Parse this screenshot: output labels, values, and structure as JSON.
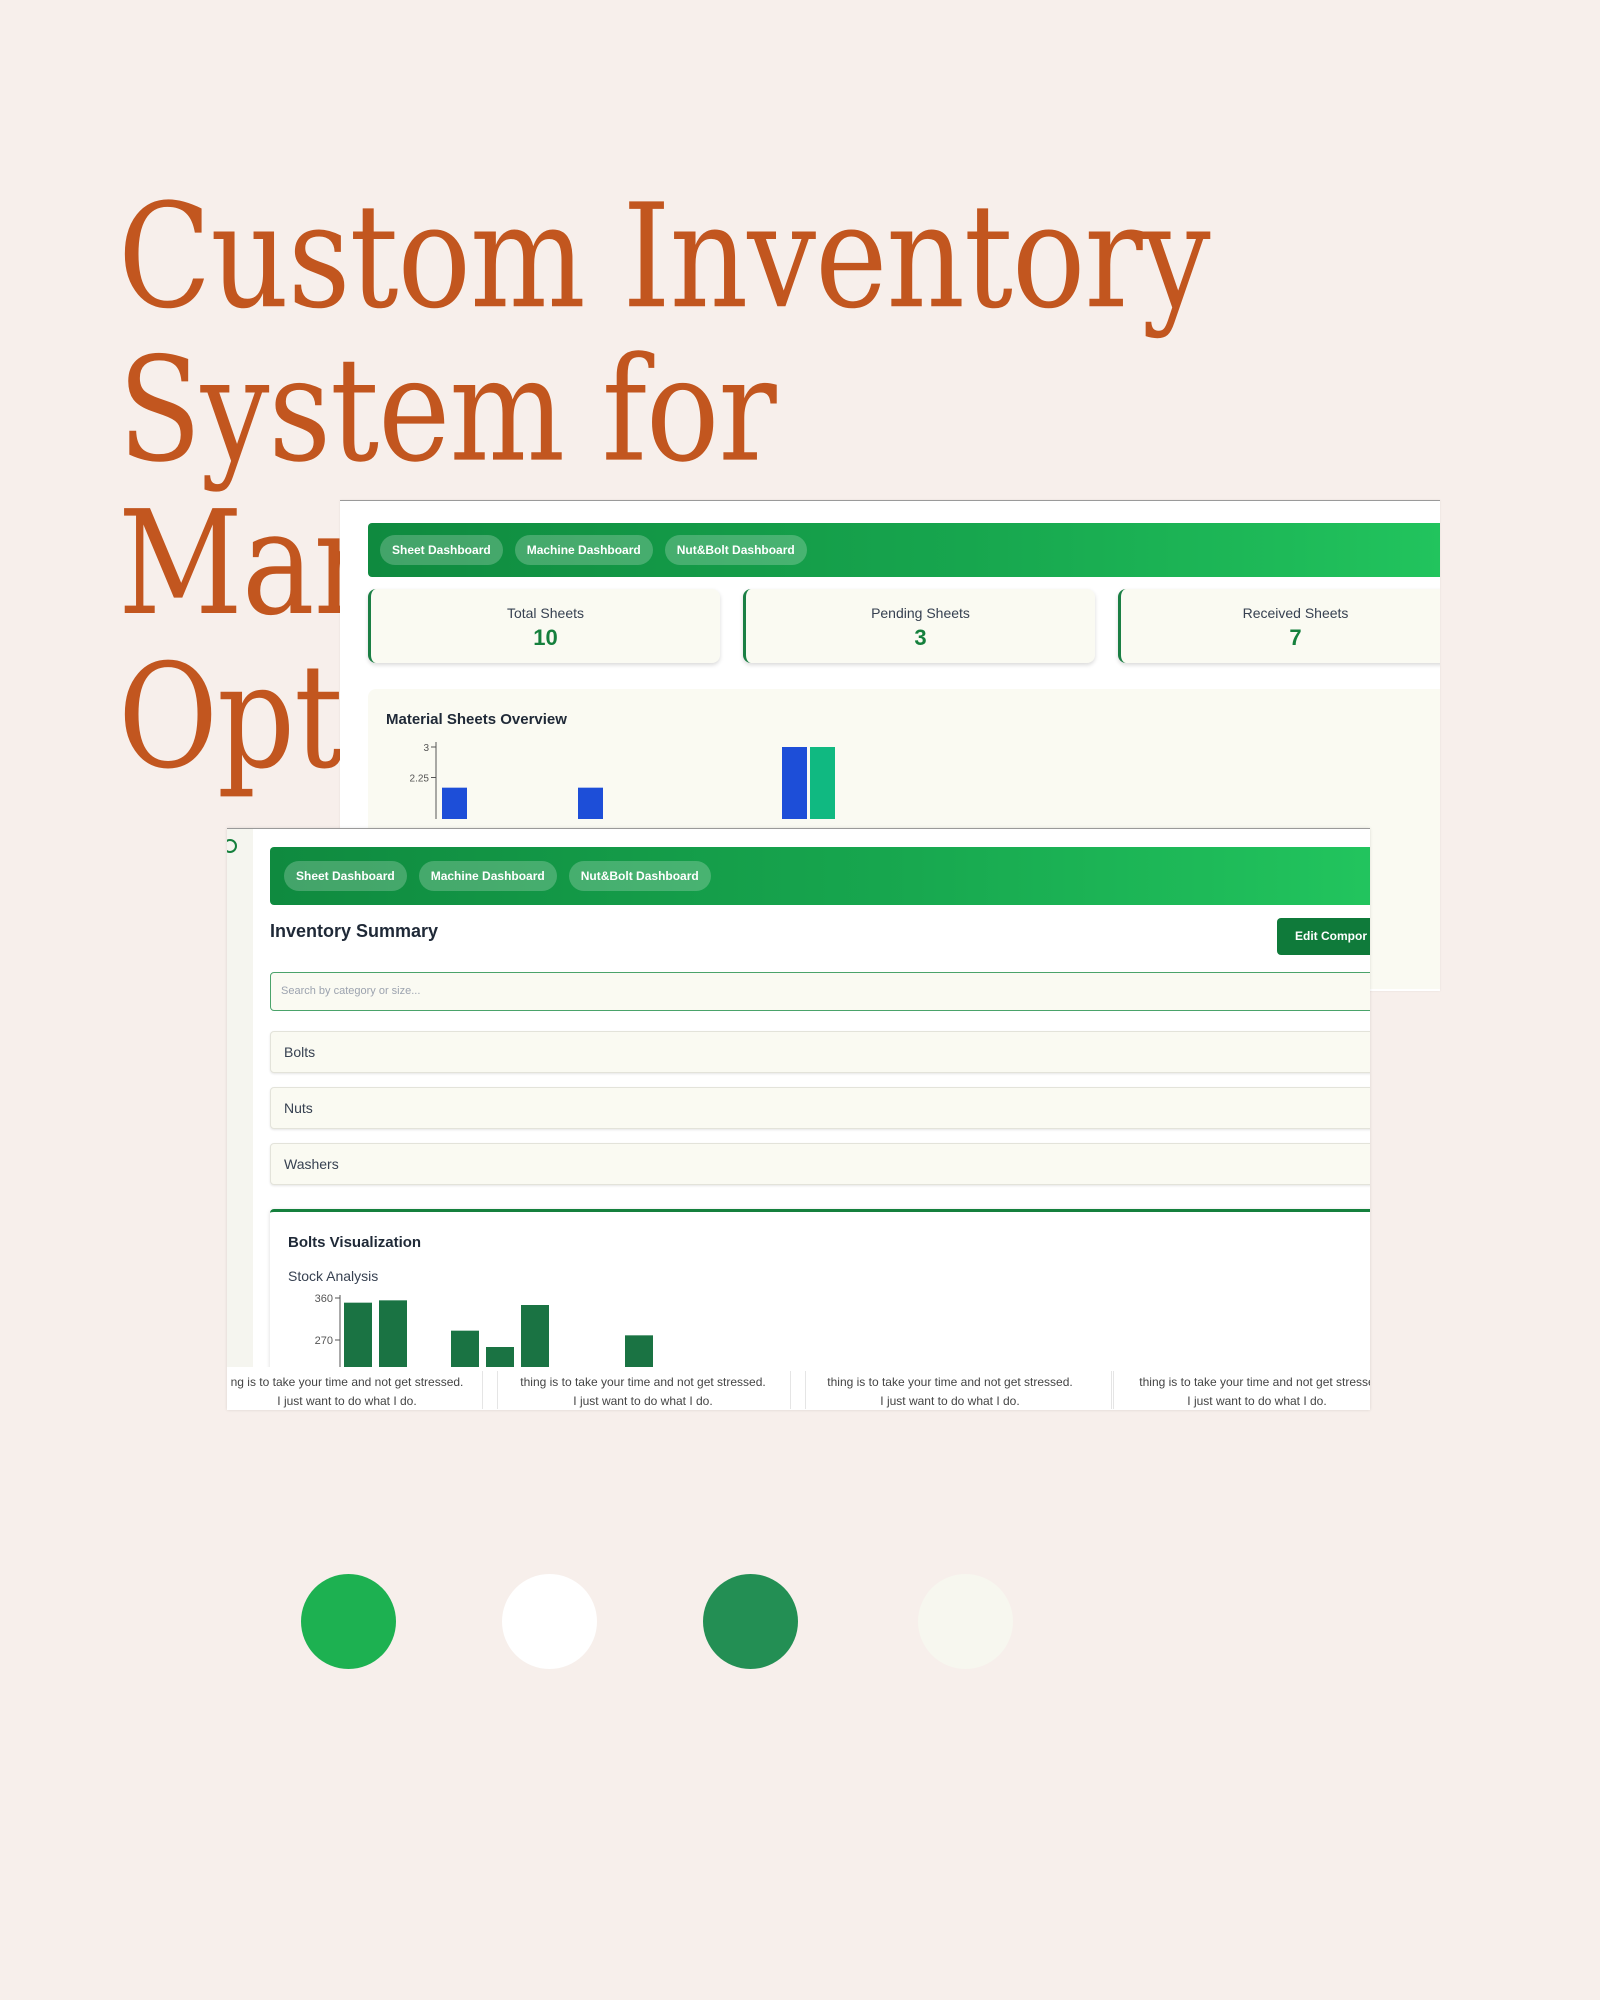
{
  "title": {
    "line1": "Custom Inventory System for",
    "line2": "Manufacturing Optimization"
  },
  "sheet_dashboard": {
    "nav": [
      "Sheet Dashboard",
      "Machine Dashboard",
      "Nut&Bolt Dashboard"
    ],
    "stats": [
      {
        "label": "Total Sheets",
        "value": "10"
      },
      {
        "label": "Pending Sheets",
        "value": "3"
      },
      {
        "label": "Received Sheets",
        "value": "7"
      }
    ],
    "chart_title": "Material Sheets Overview"
  },
  "inventory_dashboard": {
    "nav": [
      "Sheet Dashboard",
      "Machine Dashboard",
      "Nut&Bolt Dashboard"
    ],
    "summary_title": "Inventory Summary",
    "edit_button": "Edit Compor",
    "search_placeholder": "Search by category or size...",
    "categories": [
      "Bolts",
      "Nuts",
      "Washers"
    ],
    "viz_title": "Bolts Visualization",
    "viz_subtitle": "Stock Analysis",
    "footer_text_line1_first": "ng is to take your time and not get stressed.",
    "footer_text_line1": "thing is to take your time and not get stressed.",
    "footer_text_line1_last": "thing is to take your time and not get stresse",
    "footer_text_line2": "I just want to do what I do."
  },
  "chart_data": [
    {
      "type": "bar",
      "title": "Material Sheets Overview",
      "yticks": [
        "3",
        "2.25"
      ],
      "ylim": [
        0,
        3
      ],
      "colors": [
        "#1d4ed8",
        "#10b981"
      ],
      "series": [
        {
          "values": [
            2,
            2,
            3
          ]
        },
        {
          "values": [
            null,
            null,
            3
          ]
        }
      ],
      "categories": [
        "",
        "",
        ""
      ]
    },
    {
      "type": "bar",
      "title": "Bolts Visualization",
      "subtitle": "Stock Analysis",
      "yticks": [
        "360",
        "270"
      ],
      "color": "#1a7343",
      "values": [
        350,
        355,
        290,
        255,
        345,
        280
      ]
    }
  ],
  "palette": [
    "#1db151",
    "#ffffff",
    "#238f54",
    "#f7f7ef"
  ]
}
